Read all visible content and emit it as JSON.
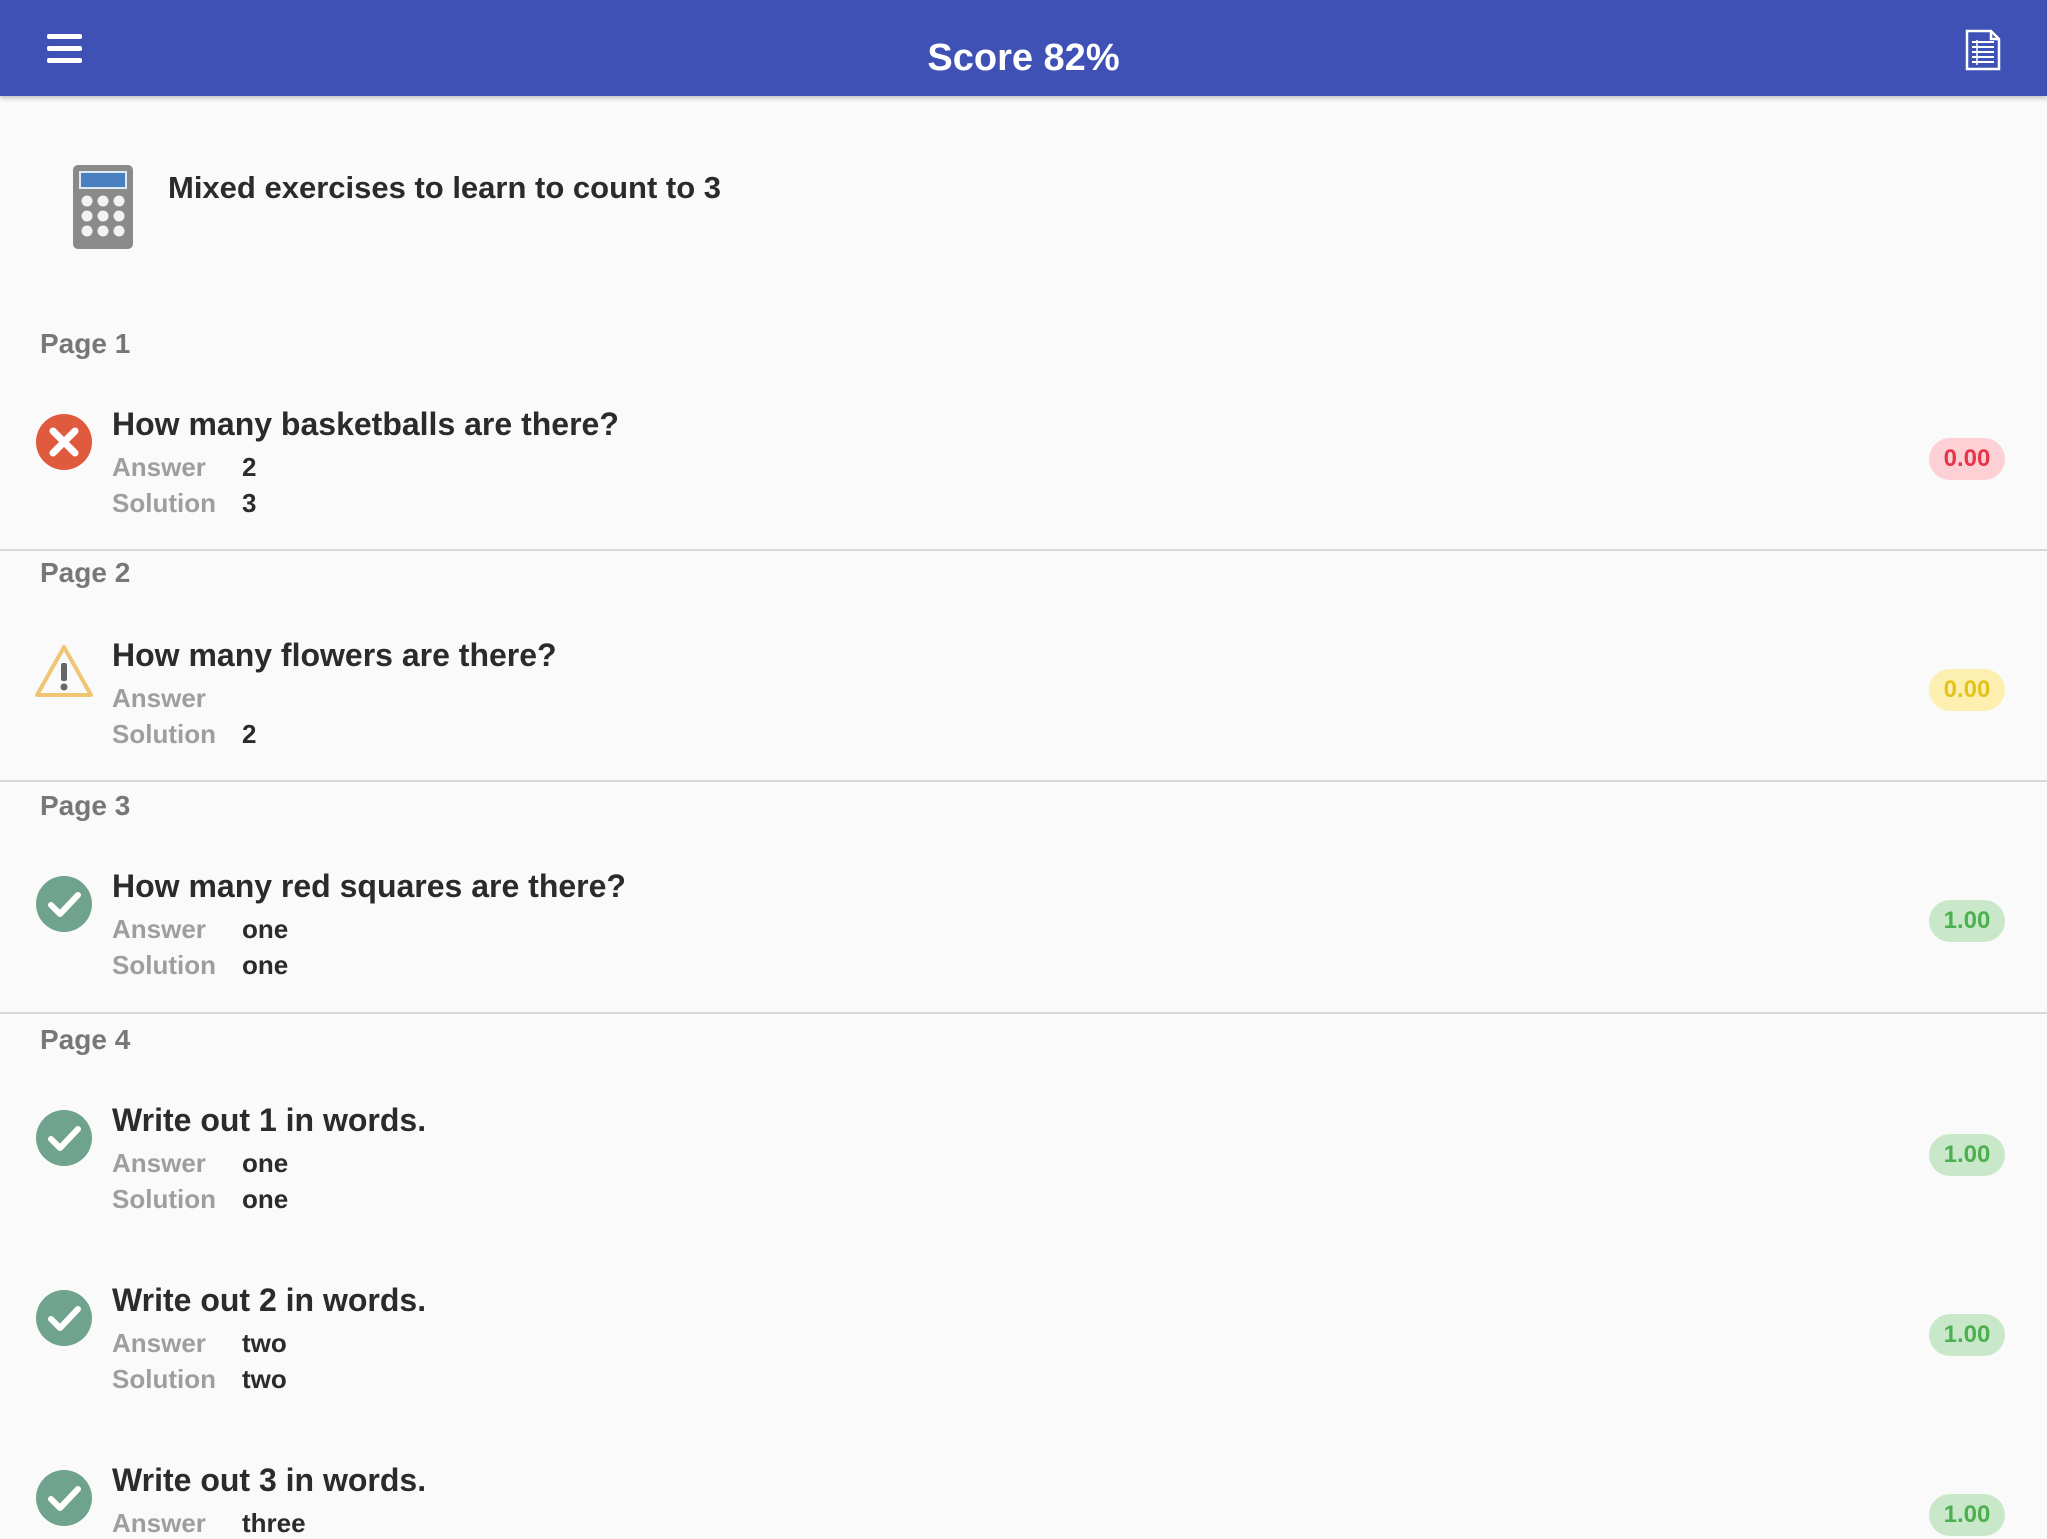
{
  "appbar": {
    "title": "Score 82%",
    "menu_icon": "hamburger-menu-icon",
    "report_icon": "document-list-icon",
    "background": "#3f51b5"
  },
  "exercise": {
    "icon": "calculator-icon",
    "title": "Mixed exercises to learn to count to 3"
  },
  "labels": {
    "answer": "Answer",
    "solution": "Solution"
  },
  "colors": {
    "wrong": "#e05a3d",
    "warning": "#f0c674",
    "correct": "#6fa38e",
    "badge_wrong_bg": "#fcd0d4",
    "badge_wrong_text": "#e8344a",
    "badge_warning_bg": "#fcefb0",
    "badge_warning_text": "#e3c21a",
    "badge_correct_bg": "#c9e8c9",
    "badge_correct_text": "#4caf50"
  },
  "pages": [
    {
      "label": "Page 1",
      "items": [
        {
          "status": "wrong",
          "status_icon": "x-circle-icon",
          "question": "How many basketballs are there?",
          "answer": "2",
          "solution": "3",
          "score": "0.00"
        }
      ]
    },
    {
      "label": "Page 2",
      "items": [
        {
          "status": "warning",
          "status_icon": "warning-triangle-icon",
          "question": "How many flowers are there?",
          "answer": "",
          "solution": "2",
          "score": "0.00"
        }
      ]
    },
    {
      "label": "Page 3",
      "items": [
        {
          "status": "correct",
          "status_icon": "check-circle-icon",
          "question": "How many red squares are there?",
          "answer": "one",
          "solution": "one",
          "score": "1.00"
        }
      ]
    },
    {
      "label": "Page 4",
      "items": [
        {
          "status": "correct",
          "status_icon": "check-circle-icon",
          "question": "Write out 1 in words.",
          "answer": "one",
          "solution": "one",
          "score": "1.00"
        },
        {
          "status": "correct",
          "status_icon": "check-circle-icon",
          "question": "Write out 2 in words.",
          "answer": "two",
          "solution": "two",
          "score": "1.00"
        },
        {
          "status": "correct",
          "status_icon": "check-circle-icon",
          "question": "Write out 3 in words.",
          "answer": "three",
          "solution": "",
          "score": "1.00"
        }
      ]
    }
  ]
}
